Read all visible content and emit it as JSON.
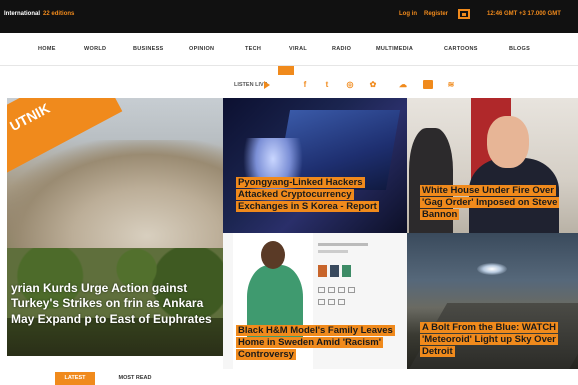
{
  "topbar": {
    "lang_label": "International",
    "lang_edition": "22 editions",
    "login": "Log in",
    "register": "Register",
    "time": "12:46 GMT +3 17.000 GMT"
  },
  "nav": {
    "items": [
      "HOME",
      "WORLD",
      "BUSINESS",
      "OPINION",
      "TECH",
      "VIRAL",
      "RADIO",
      "MULTIMEDIA",
      "CARTOONS",
      "BLOGS"
    ]
  },
  "listen": {
    "label": "LISTEN LIVE",
    "social_icons": [
      "facebook-icon",
      "twitter-icon",
      "rss-icon",
      "web-icon",
      "soundcloud-icon",
      "youtube-icon",
      "feed-icon"
    ]
  },
  "brand": {
    "logo_text": "UTNIK",
    "accent": "#f08a1c"
  },
  "stories": {
    "main": "yrian Kurds Urge Action gainst Turkey's Strikes on frin as Ankara May Expand p to East of Euphrates",
    "hack": "Pyongyang-Linked Hackers Attacked Cryptocurrency Exchanges in S Korea - Report",
    "white": "White House Under Fire Over 'Gag Order' Imposed on Steve Bannon",
    "model": "Black H&M Model's Family Leaves Home in Sweden Amid 'Racism' Controversy",
    "bolt": "A Bolt From the Blue: WATCH 'Meteoroid' Light up Sky Over Detroit"
  },
  "tabs": {
    "latest": "LATEST",
    "most": "MOST READ"
  }
}
